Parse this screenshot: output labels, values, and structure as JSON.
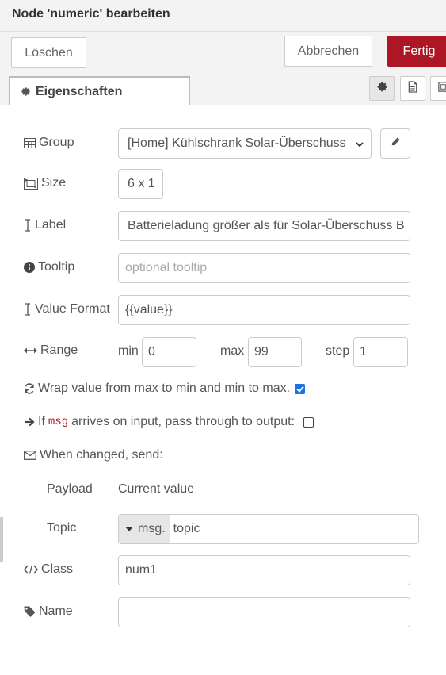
{
  "header": {
    "title": "Node 'numeric' bearbeiten"
  },
  "toolbar": {
    "delete_label": "Löschen",
    "cancel_label": "Abbrechen",
    "done_label": "Fertig"
  },
  "tabs": {
    "properties_label": "Eigenschaften",
    "icons": [
      "gear-icon",
      "document-icon",
      "frame-icon"
    ]
  },
  "form": {
    "group": {
      "label": "Group",
      "value": "[Home] Kühlschrank Solar-Überschuss"
    },
    "size": {
      "label": "Size",
      "value": "6 x 1"
    },
    "label": {
      "label": "Label",
      "value": "Batterieladung größer als für Solar-Überschuss B"
    },
    "tooltip": {
      "label": "Tooltip",
      "placeholder": "optional tooltip"
    },
    "value_format": {
      "label": "Value Format",
      "value": "{{value}}"
    },
    "range": {
      "label": "Range",
      "min_label": "min",
      "min": "0",
      "max_label": "max",
      "max": "99",
      "step_label": "step",
      "step": "1"
    },
    "wrap": {
      "label": "Wrap value from max to min and min to max.",
      "checked": true
    },
    "passthrough": {
      "prefix": "If",
      "code": "msg",
      "suffix": "arrives on input, pass through to output:",
      "checked": false
    },
    "when_changed": {
      "label": "When changed, send:"
    },
    "payload": {
      "label": "Payload",
      "value": "Current value"
    },
    "topic": {
      "label": "Topic",
      "type_prefix": "msg.",
      "value": "topic"
    },
    "class": {
      "label": "Class",
      "value": "num1"
    },
    "name": {
      "label": "Name",
      "value": ""
    }
  },
  "colors": {
    "accent": "#ad1625",
    "checkbox": "#1a73e8",
    "code": "#ad1625"
  }
}
